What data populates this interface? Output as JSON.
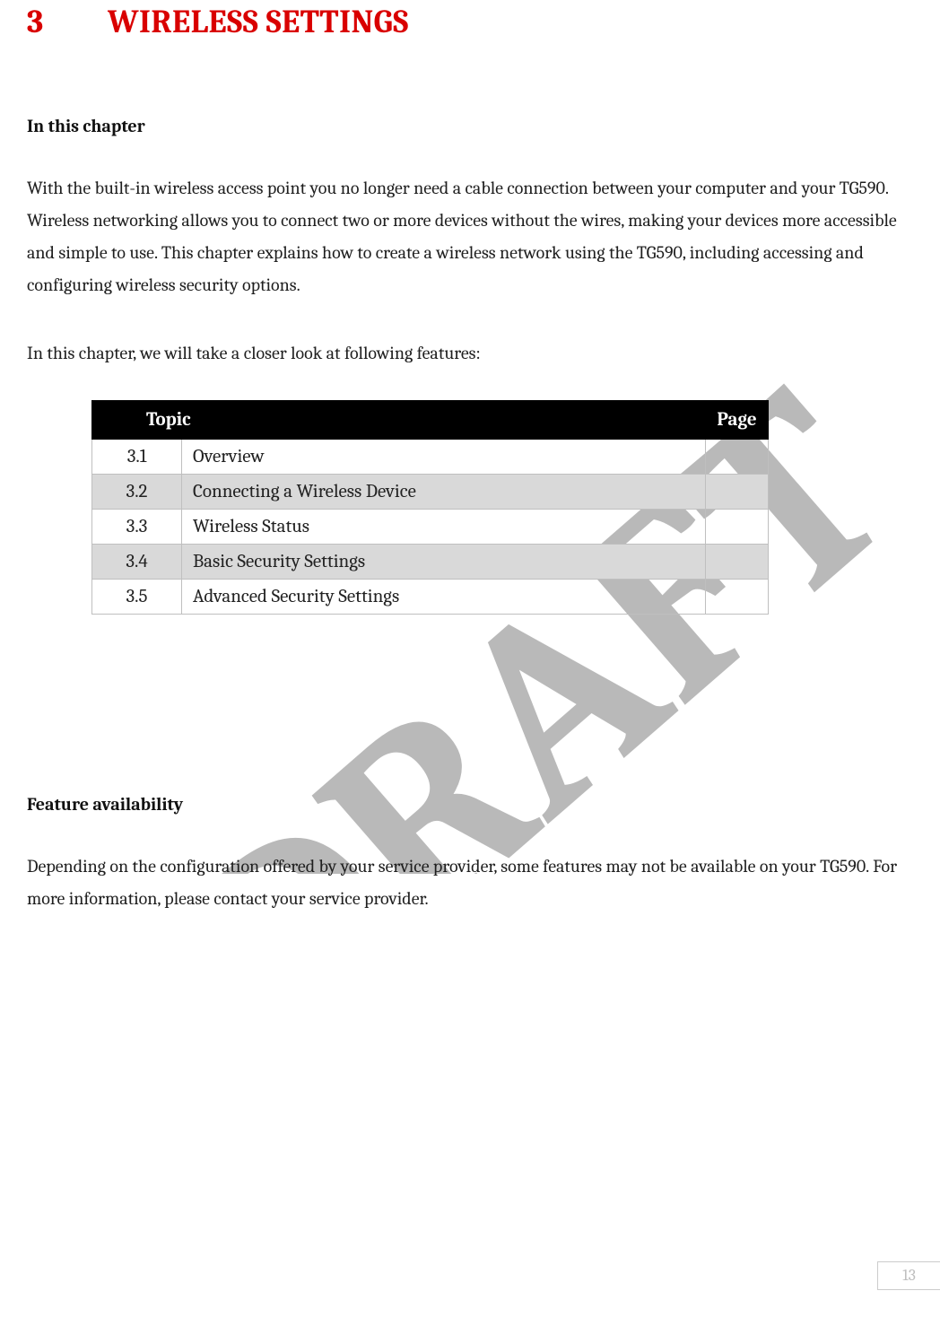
{
  "chapter": {
    "number": "3",
    "title": "WIRELESS SETTINGS"
  },
  "intro_heading": "In this chapter",
  "intro_para": "With the built-in wireless access point you no longer need a cable connection between your computer and your TG590.  Wireless networking allows you to connect two or more devices without the wires, making your devices more accessible and simple to use. This chapter explains how to create a wireless network using the TG590, including accessing and configuring wireless security options.",
  "intro_lead": "In this chapter, we will take a closer look at following features:",
  "table": {
    "headers": {
      "topic": "Topic",
      "page": "Page"
    },
    "rows": [
      {
        "num": "3.1",
        "title": "Overview",
        "page": ""
      },
      {
        "num": "3.2",
        "title": "Connecting a Wireless Device",
        "page": ""
      },
      {
        "num": "3.3",
        "title": "Wireless Status",
        "page": ""
      },
      {
        "num": "3.4",
        "title": "Basic Security Settings",
        "page": ""
      },
      {
        "num": "3.5",
        "title": "Advanced Security Settings",
        "page": ""
      }
    ]
  },
  "feature_heading": "Feature availability",
  "feature_para": "Depending on the configuration offered by your service provider, some features may not be available on your TG590. For more information, please contact your service provider.",
  "watermark_text": "DRAFT",
  "page_number": "13"
}
